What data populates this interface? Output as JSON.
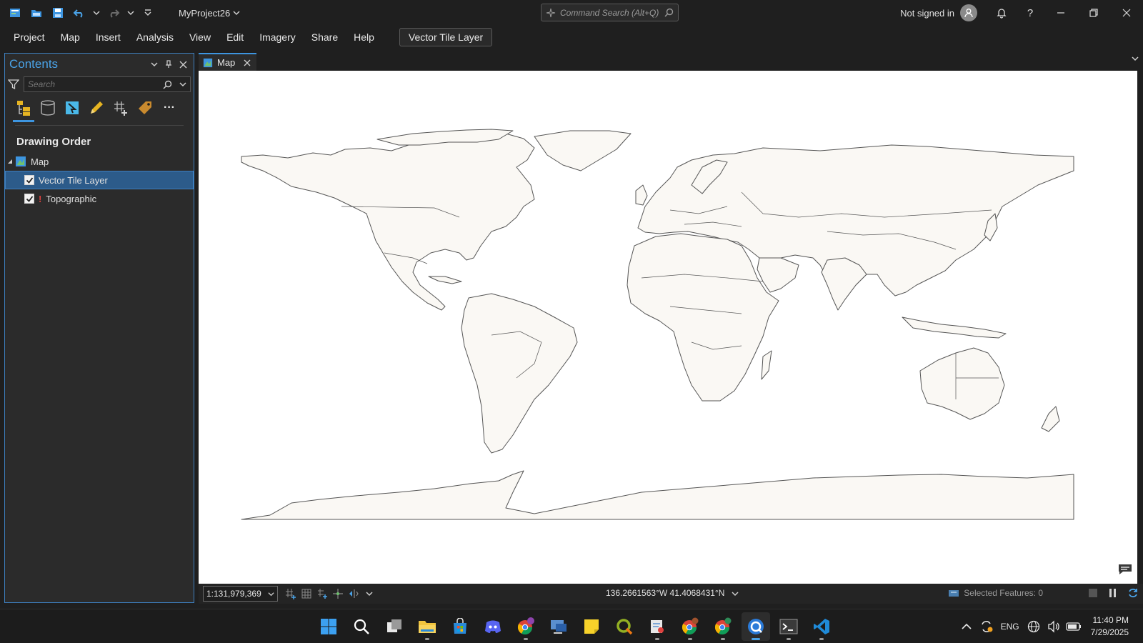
{
  "titlebar": {
    "project_title": "MyProject26",
    "command_search_placeholder": "Command Search (Alt+Q)",
    "signin_text": "Not signed in"
  },
  "ribbon": {
    "tabs": [
      "Project",
      "Map",
      "Insert",
      "Analysis",
      "View",
      "Edit",
      "Imagery",
      "Share",
      "Help"
    ],
    "contextual_tab": "Vector Tile Layer"
  },
  "contents": {
    "title": "Contents",
    "search_placeholder": "Search",
    "section_title": "Drawing Order",
    "map_node": "Map",
    "layers": [
      {
        "name": "Vector Tile Layer",
        "checked": true,
        "warning": false,
        "selected": true
      },
      {
        "name": "Topographic",
        "checked": true,
        "warning": true,
        "selected": false
      }
    ]
  },
  "map_view": {
    "tab_label": "Map"
  },
  "status": {
    "scale": "1:131,979,369",
    "coordinates": "136.2661563°W 41.4068431°N",
    "selected_features": "Selected Features: 0"
  },
  "taskbar": {
    "language": "ENG",
    "time": "11:40 PM",
    "date": "7/29/2025"
  },
  "colors": {
    "accent": "#3d95e0",
    "land_fill": "#faf8f4",
    "land_stroke": "#555555",
    "warning": "#e0413e"
  }
}
